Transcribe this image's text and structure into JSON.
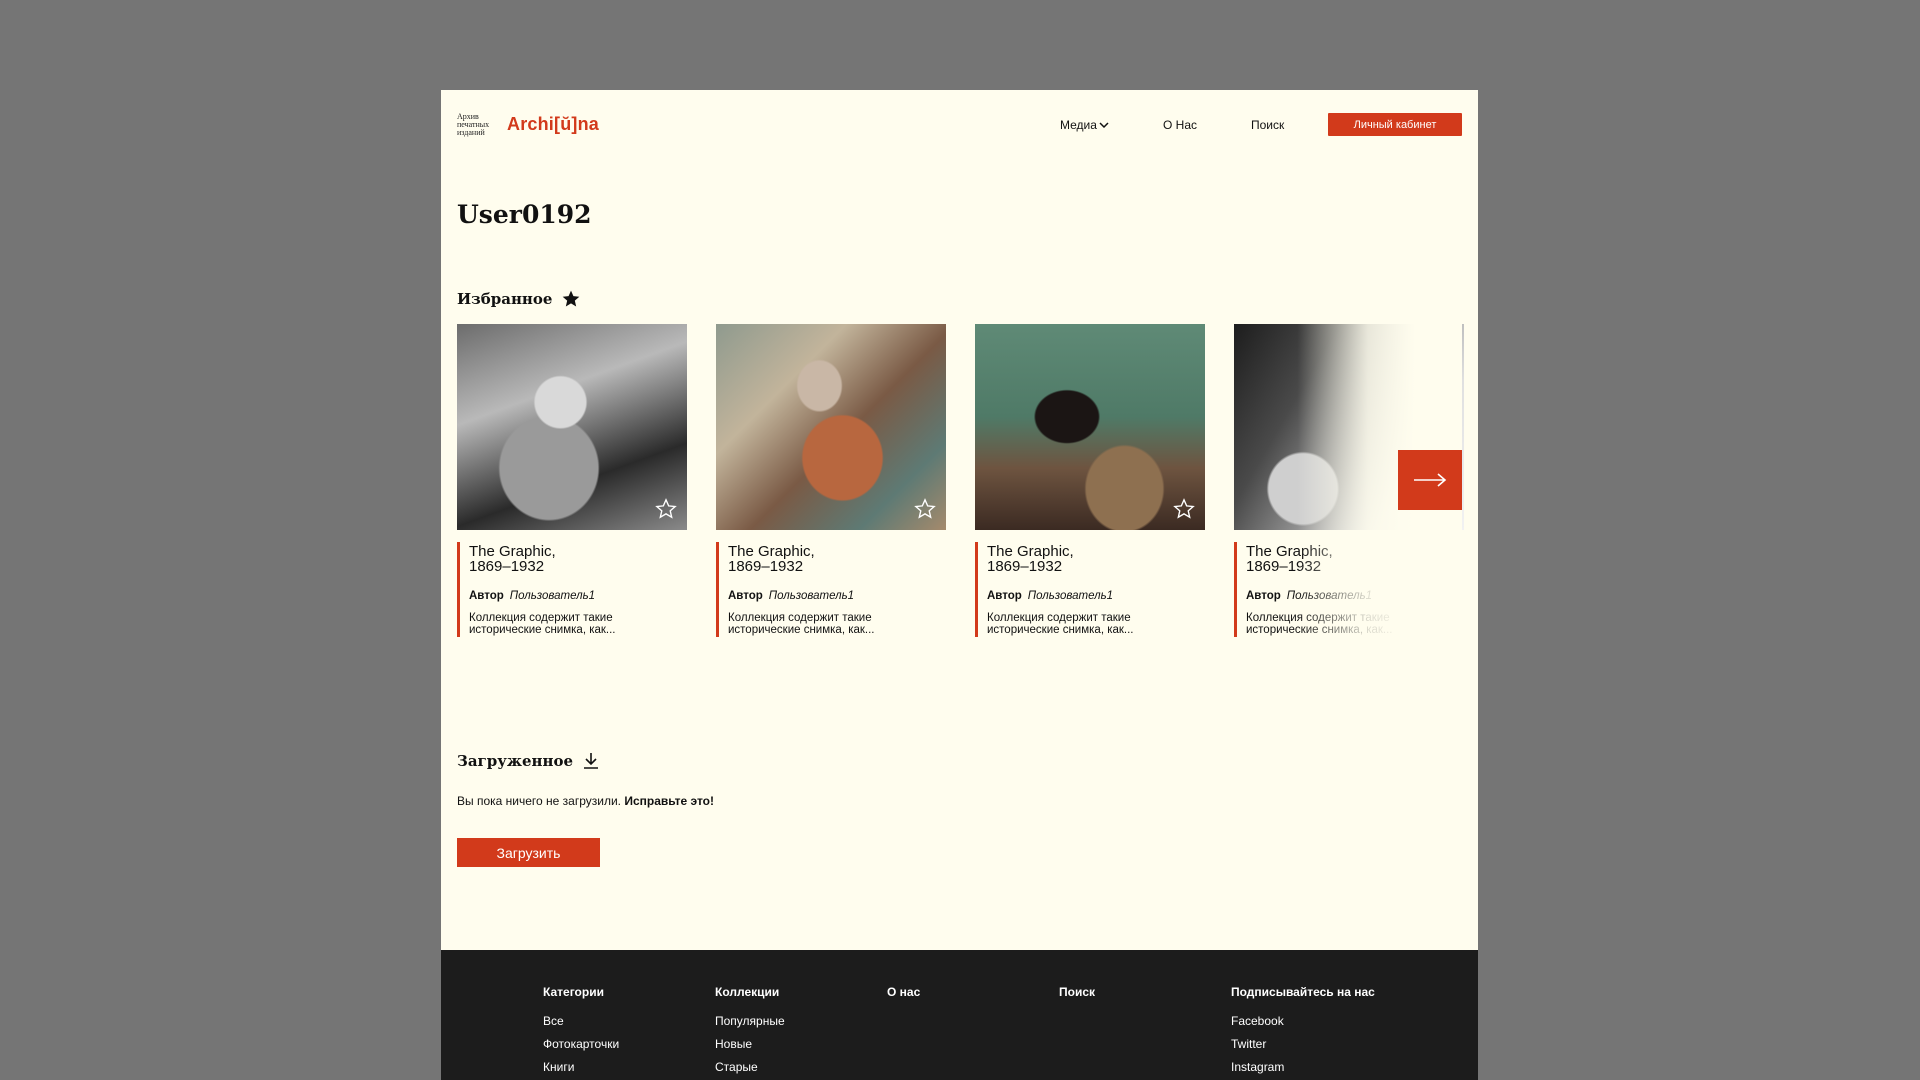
{
  "header": {
    "logo_sub": "Архив\nпечатных\nизданий",
    "logo_main": "Archi[ŭ]na",
    "nav": {
      "media": "Медиа",
      "about": "О Нас",
      "search": "Поиск"
    },
    "cabinet_button": "Личный кабинет"
  },
  "user": {
    "name": "User0192"
  },
  "favorites": {
    "title": "Избранное",
    "cards": [
      {
        "title": "The Graphic,\n1869–1932",
        "author_label": "Автор",
        "author": "Пользователь1",
        "description": "Коллекция содержит такие\nисторические снимка, как..."
      },
      {
        "title": "The Graphic,\n1869–1932",
        "author_label": "Автор",
        "author": "Пользователь1",
        "description": "Коллекция содержит такие\nисторические снимка, как..."
      },
      {
        "title": "The Graphic,\n1869–1932",
        "author_label": "Автор",
        "author": "Пользователь1",
        "description": "Коллекция содержит такие\nисторические снимка, как..."
      },
      {
        "title": "The Graphic,\n1869–1932",
        "author_label": "Автор",
        "author": "Пользователь1",
        "description": "Коллекция содержит такие\nисторические снимка, как..."
      }
    ]
  },
  "uploads": {
    "title": "Загруженное",
    "empty_text": "Вы пока ничего не загрузили.",
    "empty_cta": "Исправьте это!",
    "upload_button": "Загрузить"
  },
  "footer": {
    "categories": {
      "heading": "Категории",
      "items": [
        "Все",
        "Фотокарточки",
        "Книги"
      ]
    },
    "collections": {
      "heading": "Коллекции",
      "items": [
        "Популярные",
        "Новые",
        "Старые"
      ]
    },
    "about": {
      "heading": "О нас"
    },
    "search": {
      "heading": "Поиск"
    },
    "social": {
      "heading": "Подписывайтесь на нас",
      "items": [
        "Facebook",
        "Twitter",
        "Instagram"
      ]
    }
  },
  "colors": {
    "accent": "#d23a1b",
    "page_bg": "#fffdee",
    "footer_bg": "#1c1c1c",
    "backdrop": "#757575"
  }
}
